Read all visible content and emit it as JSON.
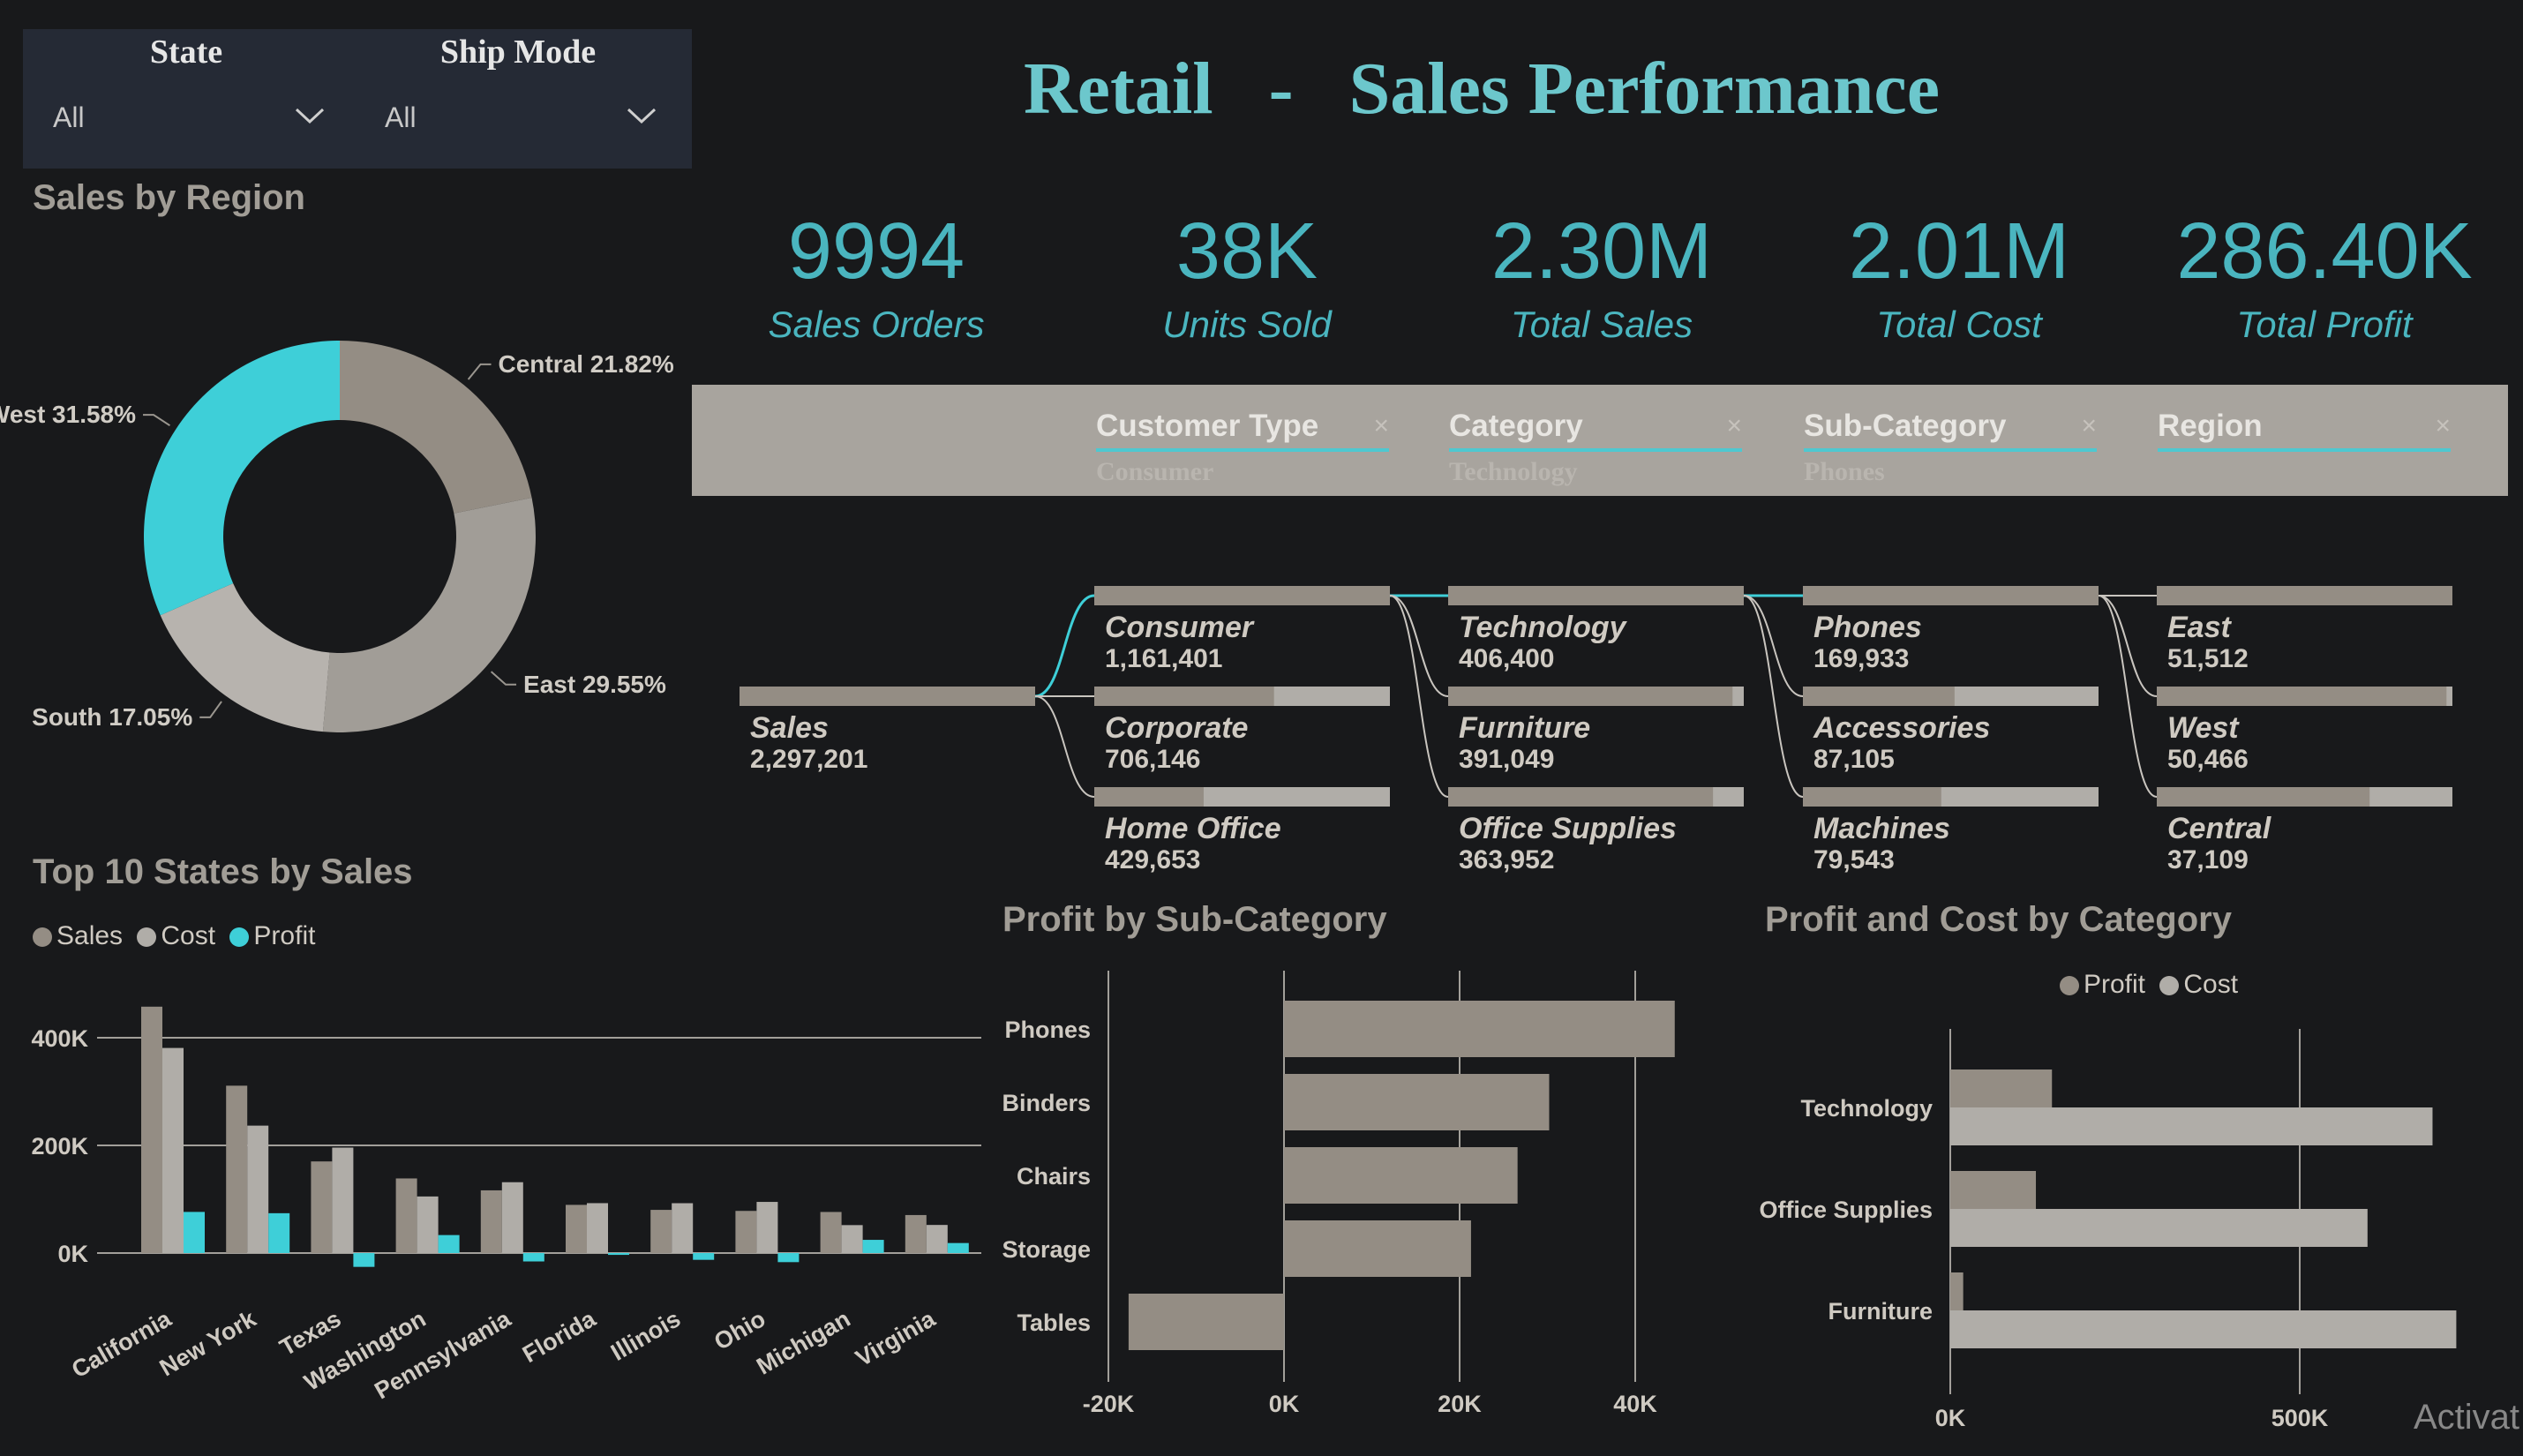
{
  "title": "Retail   -   Sales Performance",
  "filters": {
    "state": {
      "label": "State",
      "value": "All"
    },
    "ship_mode": {
      "label": "Ship Mode",
      "value": "All"
    }
  },
  "kpis": [
    {
      "value": "9994",
      "label": "Sales Orders"
    },
    {
      "value": "38K",
      "label": "Units Sold"
    },
    {
      "value": "2.30M",
      "label": "Total Sales"
    },
    {
      "value": "2.01M",
      "label": "Total Cost"
    },
    {
      "value": "286.40K",
      "label": "Total Profit"
    }
  ],
  "colors": {
    "sales": "#948d84",
    "cost": "#b0ada8",
    "profit": "#3ecfd8",
    "accent": "#6cc7cc"
  },
  "decomposition": {
    "levels": [
      {
        "name": "Customer Type",
        "selected": "Consumer"
      },
      {
        "name": "Category",
        "selected": "Technology"
      },
      {
        "name": "Sub-Category",
        "selected": "Phones"
      },
      {
        "name": "Region",
        "selected": ""
      }
    ],
    "close_glyph": "×",
    "root": {
      "label": "Sales",
      "value": "2,297,201"
    },
    "columns": [
      [
        {
          "label": "Consumer",
          "value": "1,161,401",
          "fill": 1.0
        },
        {
          "label": "Corporate",
          "value": "706,146",
          "fill": 0.608
        },
        {
          "label": "Home Office",
          "value": "429,653",
          "fill": 0.37
        }
      ],
      [
        {
          "label": "Technology",
          "value": "406,400",
          "fill": 1.0
        },
        {
          "label": "Furniture",
          "value": "391,049",
          "fill": 0.962
        },
        {
          "label": "Office Supplies",
          "value": "363,952",
          "fill": 0.896
        }
      ],
      [
        {
          "label": "Phones",
          "value": "169,933",
          "fill": 1.0
        },
        {
          "label": "Accessories",
          "value": "87,105",
          "fill": 0.513
        },
        {
          "label": "Machines",
          "value": "79,543",
          "fill": 0.468
        }
      ],
      [
        {
          "label": "East",
          "value": "51,512",
          "fill": 1.0
        },
        {
          "label": "West",
          "value": "50,466",
          "fill": 0.98
        },
        {
          "label": "Central",
          "value": "37,109",
          "fill": 0.72
        }
      ]
    ]
  },
  "chart_data": [
    {
      "type": "pie",
      "title": "Sales by Region",
      "donut": true,
      "slices": [
        {
          "name": "Central",
          "value": 21.82,
          "label": "Central 21.82%",
          "color": "#948d84"
        },
        {
          "name": "East",
          "value": 29.55,
          "label": "East 29.55%",
          "color": "#a19d97"
        },
        {
          "name": "South",
          "value": 17.05,
          "label": "South 17.05%",
          "color": "#b7b3ae"
        },
        {
          "name": "West",
          "value": 31.58,
          "label": "West 31.58%",
          "color": "#3ecfd8"
        }
      ]
    },
    {
      "type": "bar",
      "title": "Top 10 States by Sales",
      "categories": [
        "California",
        "New York",
        "Texas",
        "Washington",
        "Pennsylvania",
        "Florida",
        "Illinois",
        "Ohio",
        "Michigan",
        "Virginia"
      ],
      "series": [
        {
          "name": "Sales",
          "values": [
            457700,
            310900,
            170200,
            138600,
            116500,
            89500,
            80200,
            78300,
            76300,
            70600
          ]
        },
        {
          "name": "Cost",
          "values": [
            381000,
            236700,
            195900,
            105100,
            131600,
            92700,
            92600,
            95000,
            51900,
            52200
          ]
        },
        {
          "name": "Profit",
          "values": [
            76400,
            74000,
            -25700,
            33400,
            -15600,
            -3400,
            -12600,
            -16900,
            24500,
            18600
          ]
        }
      ],
      "yticks": [
        "400K",
        "200K",
        "0K"
      ],
      "ylim": [
        -40000,
        470000
      ],
      "legend": "top-left"
    },
    {
      "type": "bar",
      "orientation": "horizontal",
      "title": "Profit by Sub-Category",
      "categories": [
        "Phones",
        "Binders",
        "Chairs",
        "Storage",
        "Tables"
      ],
      "values": [
        44500,
        30200,
        26600,
        21300,
        -17700
      ],
      "xticks": [
        "-20K",
        "0K",
        "20K",
        "40K"
      ],
      "xlim": [
        -20000,
        47000
      ]
    },
    {
      "type": "bar",
      "orientation": "horizontal",
      "title": "Profit and Cost by Category",
      "categories": [
        "Technology",
        "Office Supplies",
        "Furniture"
      ],
      "series": [
        {
          "name": "Profit",
          "values": [
            145500,
            122500,
            18500
          ]
        },
        {
          "name": "Cost",
          "values": [
            690000,
            597000,
            724000
          ]
        }
      ],
      "xticks": [
        "0K",
        "500K"
      ],
      "xlim": [
        0,
        720000
      ],
      "legend": "top"
    }
  ],
  "watermark": "Activat"
}
